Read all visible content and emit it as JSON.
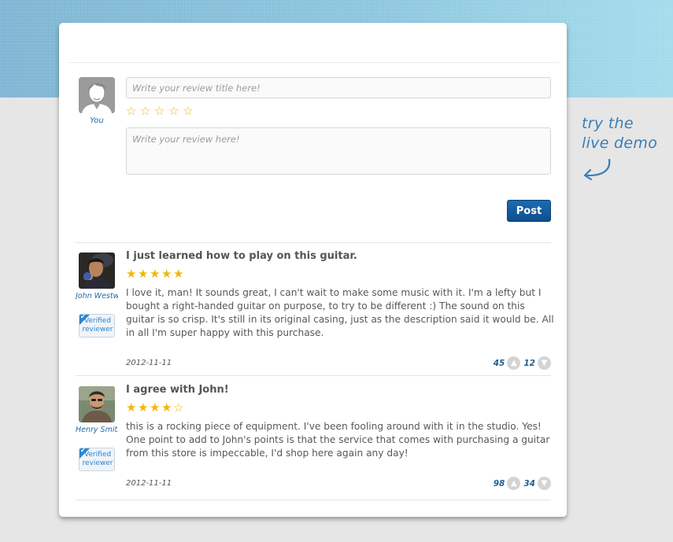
{
  "composer": {
    "avatar_label": "You",
    "title_placeholder": "Write your review title here!",
    "body_placeholder": "Write your review here!",
    "rating_stars": 5,
    "post_label": "Post"
  },
  "reviews": [
    {
      "reviewer": "John Westwood",
      "badge": "Verified reviewer",
      "title": "I just learned how to play on this guitar.",
      "rating": 5,
      "stars_text": "★★★★★",
      "text": "I love it, man! It sounds great, I can't wait to make some music with it. I'm a lefty but I bought a right-handed guitar on purpose, to try to be different :) The sound on this guitar is so crisp. It's still in its original casing, just as the description said it would be. All in all I'm super happy with this purchase.",
      "date": "2012-11-11",
      "upvotes": "45",
      "downvotes": "12"
    },
    {
      "reviewer": "Henry Smith",
      "badge": "Verified reviewer",
      "title": "I agree with John!",
      "rating": 4,
      "stars_text": "★★★★☆",
      "text": "this is a rocking piece of equipment. I've been fooling around with it in the studio. Yes! One point to add to John's points is that the service that comes with purchasing a guitar from this store is impeccable, I'd shop here again any day!",
      "date": "2012-11-11",
      "upvotes": "98",
      "downvotes": "34"
    }
  ],
  "demo": {
    "line1": "try the",
    "line2": "live demo"
  },
  "colors": {
    "accent": "#1f6aa8",
    "star": "#f2b705",
    "post_button": "#0e4f8d"
  }
}
